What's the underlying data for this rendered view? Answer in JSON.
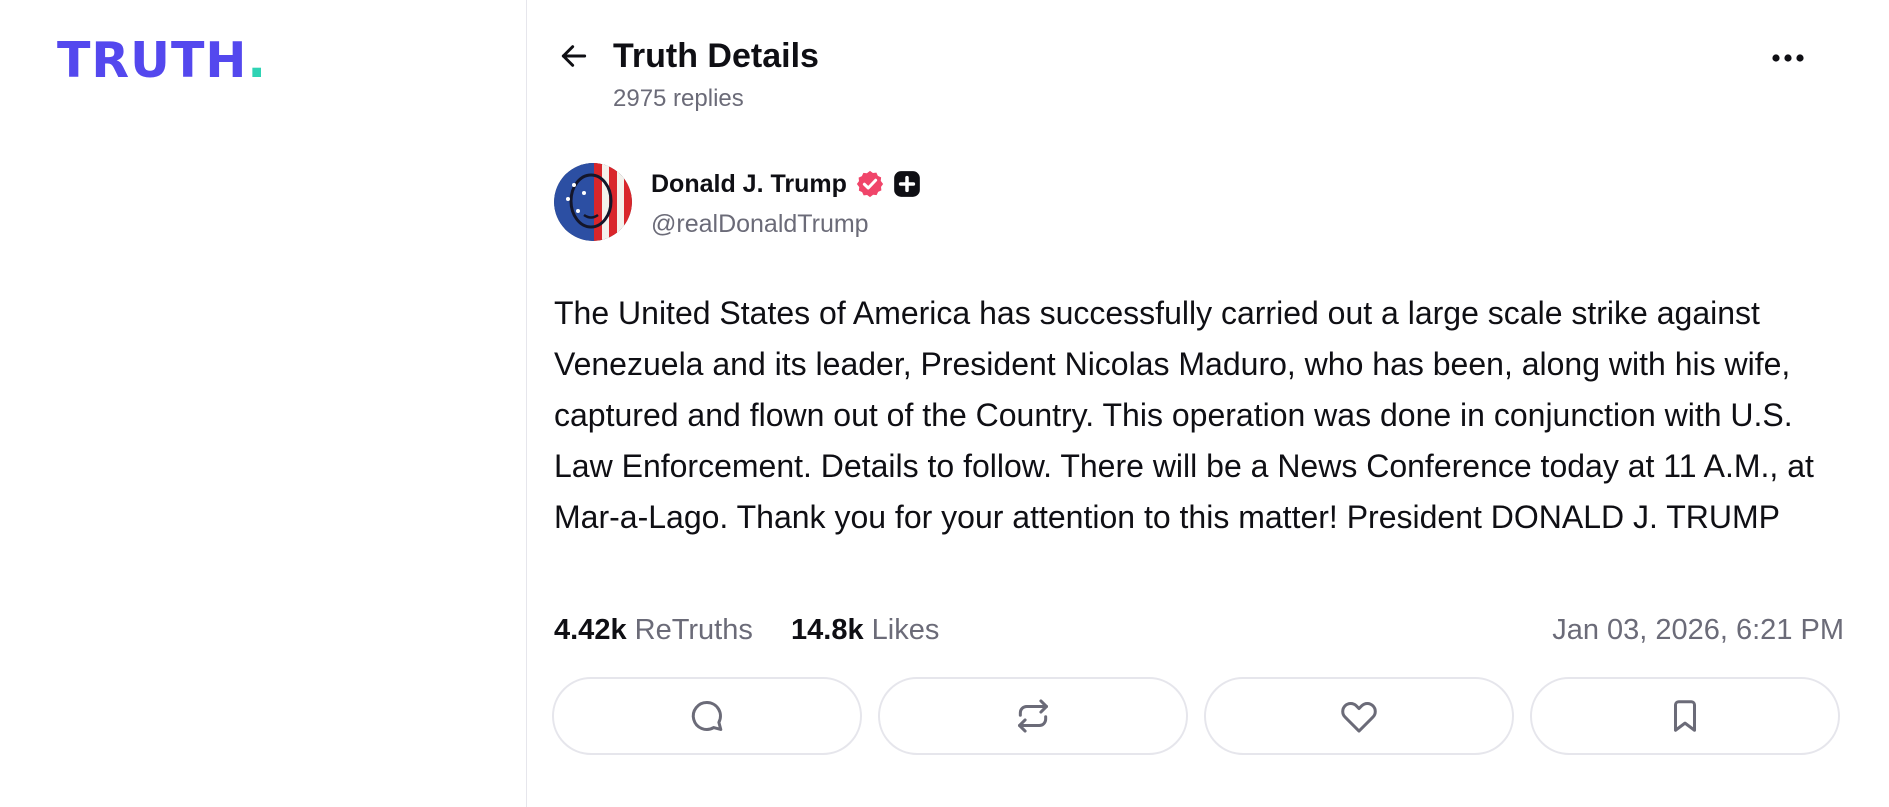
{
  "logo": {
    "text": "TRUTH",
    "dot": "."
  },
  "header": {
    "title": "Truth Details",
    "reply_count": "2975 replies"
  },
  "post": {
    "author": {
      "name": "Donald J. Trump",
      "handle": "@realDonaldTrump",
      "verified": true,
      "badge": "plus-badge"
    },
    "text": "The United States of America has successfully carried out a large scale strike against Venezuela and its leader, President Nicolas Maduro, who has been, along with his wife, captured and flown out of the Country. This operation was done in conjunction with U.S. Law Enforcement. Details to follow. There will be a News Conference today at 11 A.M., at Mar-a-Lago. Thank you for your attention to this matter! President DONALD J. TRUMP",
    "stats": {
      "retruths_count": "4.42k",
      "retruths_label": "ReTruths",
      "likes_count": "14.8k",
      "likes_label": "Likes"
    },
    "timestamp": "Jan 03, 2026, 6:21 PM"
  },
  "actions": [
    {
      "icon": "reply-icon"
    },
    {
      "icon": "retruth-icon"
    },
    {
      "icon": "like-icon"
    },
    {
      "icon": "bookmark-icon"
    }
  ],
  "colors": {
    "brand": "#5448ee",
    "brand_accent": "#2fd3b4",
    "verified": "#f0456a",
    "muted_text": "#6b6b78",
    "border": "#e6e6ec"
  }
}
